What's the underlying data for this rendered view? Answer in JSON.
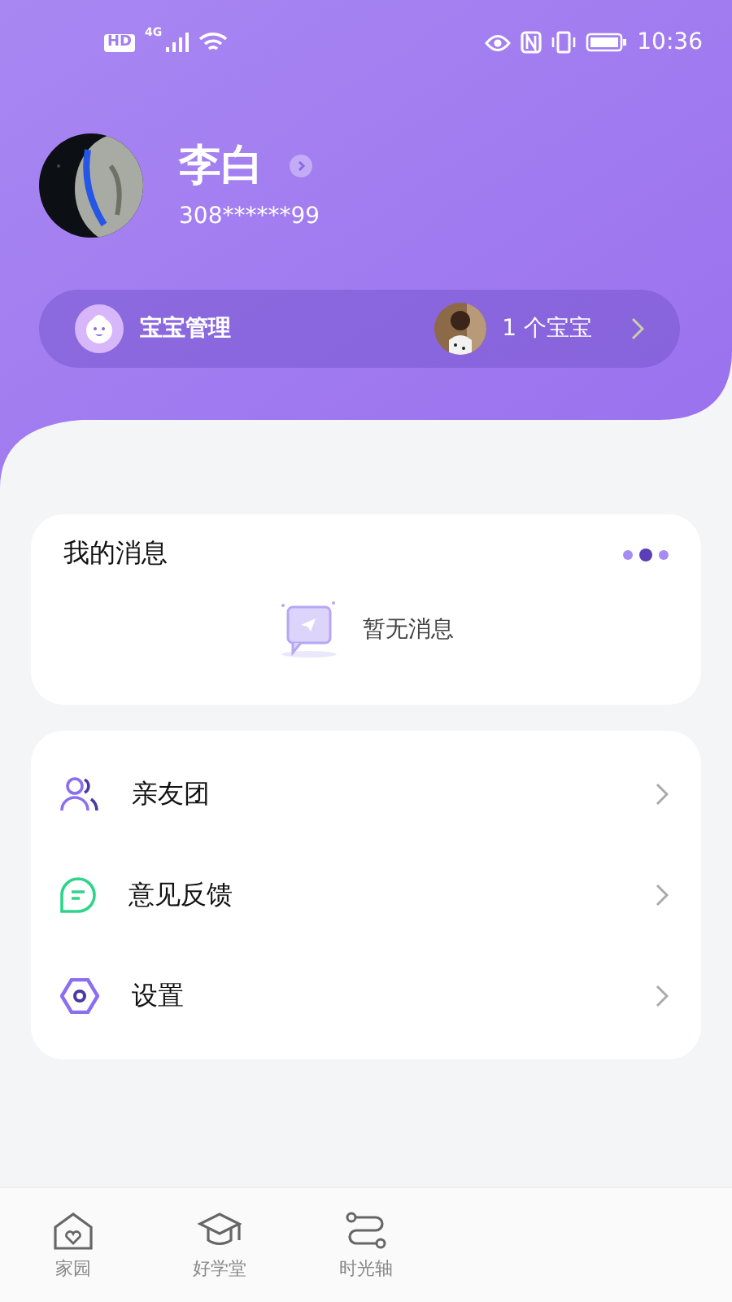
{
  "status_bar": {
    "badges": [
      "HD",
      "4G"
    ],
    "time": "10:36"
  },
  "profile": {
    "name": "李白",
    "account": "308******99"
  },
  "baby_bar": {
    "label": "宝宝管理",
    "count": "1 个宝宝"
  },
  "messages": {
    "title": "我的消息",
    "pager": [
      {
        "selected": false
      },
      {
        "selected": true
      },
      {
        "selected": false
      }
    ],
    "empty_text": "暂无消息"
  },
  "menu": [
    {
      "kind": "people",
      "label": "亲友团"
    },
    {
      "kind": "feedback",
      "label": "意见反馈"
    },
    {
      "kind": "settings",
      "label": "设置"
    }
  ],
  "tab_bar": [
    {
      "kind": "home",
      "label": "家园"
    },
    {
      "kind": "school",
      "label": "好学堂"
    },
    {
      "kind": "timeline",
      "label": "时光轴"
    }
  ]
}
